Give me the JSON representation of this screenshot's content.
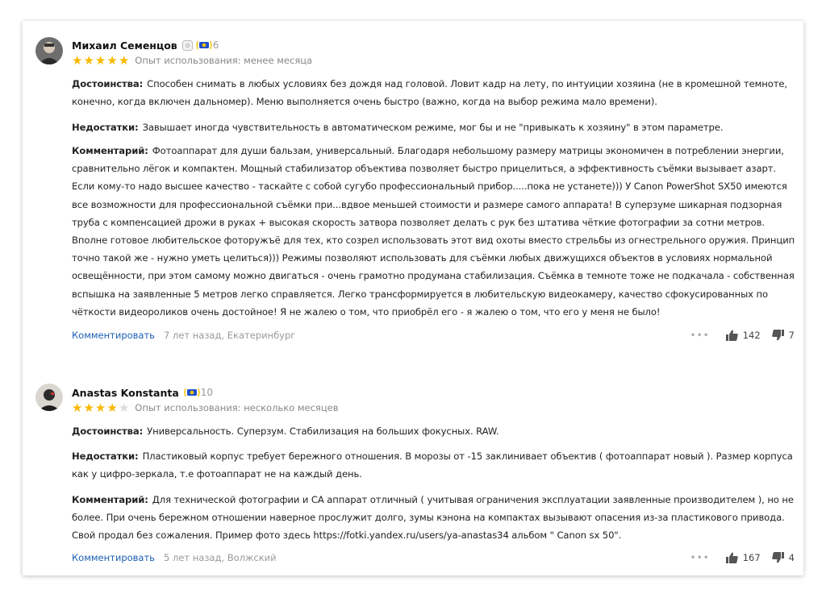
{
  "labels": {
    "pros": "Достоинства:",
    "cons": "Недостатки:",
    "comment": "Комментарий:",
    "comment_link": "Комментировать"
  },
  "colors": {
    "star": "#f9b800",
    "link": "#1a5fb4",
    "medal_blue": "#1f4fc9",
    "medal_yellow": "#f5c400"
  },
  "reviews": [
    {
      "author": "Михаил Семенцов",
      "medal_count": "6",
      "rating": 5,
      "experience": "Опыт использования: менее месяца",
      "pros": "Способен снимать в любых условиях без дождя над головой. Ловит кадр на лету, по интуиции хозяина (не в кромешной темноте, конечно, когда включен дальномер). Меню выполняется очень быстро (важно, когда на выбор режима мало времени).",
      "cons": "Завышает иногда чувствительность в автоматическом режиме, мог бы и не \"привыкать к хозяину\" в этом параметре.",
      "comment": "Фотоаппарат для души бальзам, универсальный. Благодаря небольшому размеру матрицы экономичен в потреблении энергии, сравнительно лёгок и компактен. Мощный стабилизатор объектива позволяет быстро прицелиться, а эффективность съёмки вызывает азарт. Если кому-то надо высшее качество - таскайте с собой сугубо профессиональный прибор.....пока не устанете))) У Canon PowerShot SX50 имеются все возможности для профессиональной съёмки при...вдвое меньшей стоимости и размере самого аппарата! В суперзуме шикарная подзорная труба с компенсацией дрожи в руках + высокая скорость затвора позволяет делать с рук без штатива чёткие фотографии за сотни метров. Вполне готовое любительское фоторужъё для тех, кто созрел использовать этот вид охоты вместо стрельбы из огнестрельного оружия. Принцип точно такой же - нужно уметь целиться))) Режимы позволяют использовать для съёмки любых движущихся объектов в условиях нормальной освещённости, при этом самому можно двигаться - очень грамотно продумана стабилизация. Съёмка в темноте тоже не подкачала - собственная вспышка на заявленные 5 метров легко справляется. Легко трансформируется в любительскую видеокамеру, качество сфокусированных по чёткости видеороликов очень достойное! Я не жалею о том, что приобрёл его - я жалею о том, что его у меня не было!",
      "meta": "7 лет назад, Екатеринбург",
      "likes": "142",
      "dislikes": "7"
    },
    {
      "author": "Anastas Konstanta",
      "medal_count": "10",
      "rating": 4,
      "experience": "Опыт использования: несколько месяцев",
      "pros": "Универсальность. Суперзум. Стабилизация на больших фокусных. RAW.",
      "cons": "Пластиковый корпус требует бережного отношения. В морозы от -15 заклинивает объектив ( фотоаппарат новый ). Размер корпуса как у цифро-зеркала, т.е фотоаппарат не на каждый день.",
      "comment": "Для технической фотографии и СА аппарат отличный ( учитывая ограничения эксплуатации заявленные производителем ), но не более. При очень бережном отношении наверное прослужит долго, зумы кэнона на компактах вызывают опасения из-за пластикового привода. Свой продал без сожаления. Пример фото здесь https://fotki.yandex.ru/users/ya-anastas34 альбом \" Canon sx 50\".",
      "meta": "5 лет назад, Волжский",
      "likes": "167",
      "dislikes": "4"
    }
  ]
}
